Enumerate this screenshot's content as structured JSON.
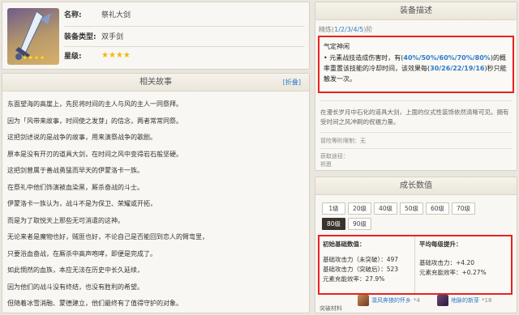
{
  "info": {
    "name_key": "名称:",
    "name_val": "祭礼大剑",
    "type_key": "装备类型:",
    "type_val": "双手剑",
    "rarity_key": "星级:",
    "rarity_stars": "★★★★",
    "portrait_stars": "★★★★"
  },
  "story": {
    "title": "相关故事",
    "collapse": "[折叠]",
    "lines": [
      "东面望海的高崖上，先民将时间的主人与风的主人一同祭拜。",
      "因为「风带来故事，时间使之发芽」的信念，两者常常同祭。",
      "这把剑述说的是战争的故事，用来演祭战争的歌剧。",
      "原本是没有开刃的道具大剑，在时间之风中变得岩石般坚硬。",
      "这把剑曾属于善战勇猛而早天的伊蒙洛卡一族。",
      "在祭礼中他们饰演被血染黑，厮杀奋战的斗士。",
      "伊蒙洛卡一族认为，战斗不是为保卫、荣耀或开拓，",
      "而是为了取悦天上那些无可消遣的这神。",
      "无论来者是魔物也好，贼匪也好，不论自己是否能回到恋人的臂弯里，",
      "只要浴血奋战，在厮杀中高声咆哮，即便是完成了。",
      "如此惘然的血族，本应无法在历史中长久延续，",
      "因为他们的战斗没有终结，也没有胜利的希望。",
      "但随着冰雪消融、蒙德建立，他们最终有了值得守护的对象。"
    ]
  },
  "equip": {
    "title": "装备描述",
    "refine_prefix": "精炼(",
    "refine_levels": "1/2/3/4/5",
    "refine_suffix": ")阶",
    "passive_name": "气定神闲",
    "passive_p1": "• 元素战技造成伤害时，有(",
    "passive_v1": "40%/50%/60%/70%/80%",
    "passive_p2": ")的概率重置该技能的冷却时间，该效果每(",
    "passive_v2": "30/26/22/19/16",
    "passive_p3": ")秒只能触发一次。",
    "lore": "在漫长岁月中石化的道具大剑，上面的仪式性装饰依然清晰可见。拥有受时间之风冲刷的祝福力量。",
    "mod_limit": "冒险等阶限制：无",
    "obtain_label": "获取途径：",
    "obtain_val": "祈愿"
  },
  "growth": {
    "title": "成长数值",
    "levels_row1": [
      "1级",
      "20级",
      "40级",
      "50级",
      "60级",
      "70级"
    ],
    "levels_row2": [
      "80级",
      "90级"
    ],
    "active_level": "80级",
    "base_head": "初始基础数值：",
    "base_atk": "基础攻击力（未突破）：497",
    "base_atk2": "基础攻击力（突破后）：523",
    "base_er": "元素充能效率：27.9%",
    "avg_head": "平均每级提升：",
    "avg_atk": "基础攻击力：+4.20",
    "avg_er": "元素充能效率：+0.27%",
    "material_label": "突破材料",
    "mat1_name": "凛风奔狼的怀乡",
    "mat1_count": "*4",
    "mat2_name": "地脉的新芽",
    "mat2_count": "*18"
  },
  "colors": {
    "highlight_box": "#e8231f",
    "link_blue": "#2d7ac9",
    "star_gold": "#f5b60b"
  }
}
